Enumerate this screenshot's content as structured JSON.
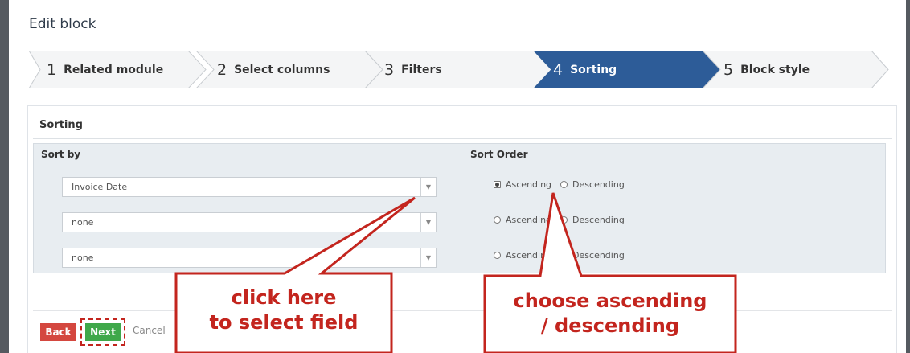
{
  "window": {
    "title": "Edit block"
  },
  "wizard": {
    "steps": [
      {
        "num": "1",
        "label": "Related module",
        "active": false
      },
      {
        "num": "2",
        "label": "Select columns",
        "active": false
      },
      {
        "num": "3",
        "label": "Filters",
        "active": false
      },
      {
        "num": "4",
        "label": "Sorting",
        "active": true
      },
      {
        "num": "5",
        "label": "Block style",
        "active": false
      }
    ],
    "active_color": "#2d5c98",
    "inactive_color": "#f4f5f6"
  },
  "sorting": {
    "title": "Sorting",
    "sort_by_header": "Sort by",
    "sort_order_header": "Sort Order",
    "rows": [
      {
        "field": "Invoice Date",
        "ascending": "Ascending",
        "descending": "Descending",
        "selected": "ascending"
      },
      {
        "field": "none",
        "ascending": "Ascending",
        "descending": "Descending",
        "selected": ""
      },
      {
        "field": "none",
        "ascending": "Ascending",
        "descending": "Descending",
        "selected": ""
      }
    ]
  },
  "actions": {
    "back": "Back",
    "next": "Next",
    "cancel": "Cancel"
  },
  "annotations": {
    "callout_left_line1": "click here",
    "callout_left_line2": "to select field",
    "callout_right_line1": "choose ascending",
    "callout_right_line2": "/ descending",
    "color": "#c3251e"
  }
}
